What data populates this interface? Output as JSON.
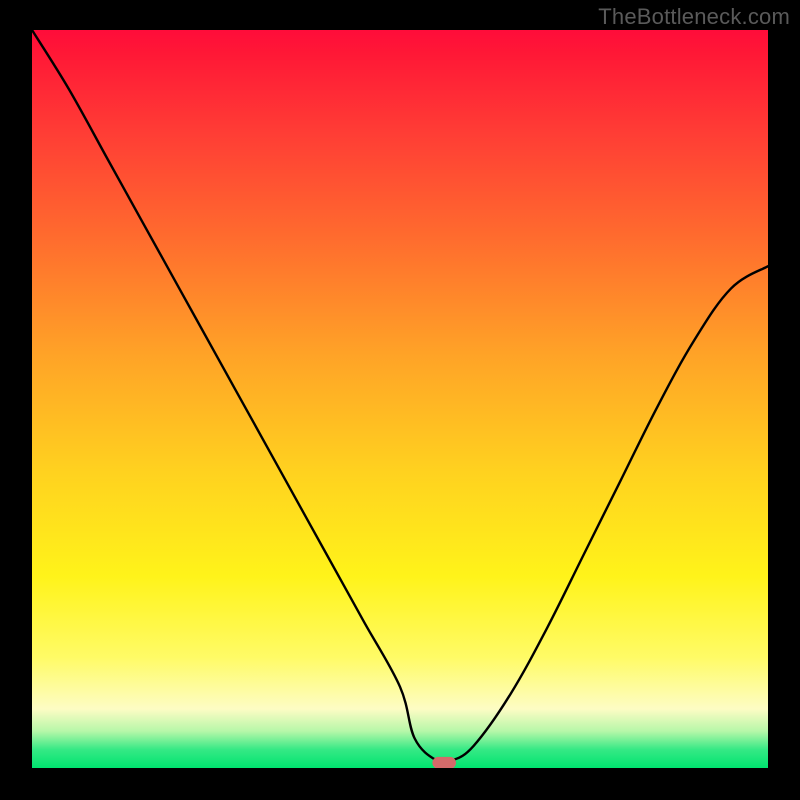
{
  "watermark": "TheBottleneck.com",
  "colors": {
    "frame_bg": "#000000",
    "watermark_text": "#5a5a5a",
    "curve_stroke": "#000000",
    "marker_fill": "#d46a6a",
    "gradient_stops": [
      "#ff0c3a",
      "#ff1736",
      "#ff3d35",
      "#ff6b2e",
      "#ffa327",
      "#ffd21f",
      "#fff31a",
      "#fffb66",
      "#fdfcc4",
      "#b7f7a9",
      "#35e985",
      "#00e46f"
    ]
  },
  "chart_data": {
    "type": "line",
    "title": "",
    "xlabel": "",
    "ylabel": "",
    "xlim": [
      0,
      100
    ],
    "ylim": [
      0,
      100
    ],
    "grid": false,
    "legend": false,
    "background": "vertical red→orange→yellow→green gradient (bottleneck heat map)",
    "series": [
      {
        "name": "bottleneck-curve",
        "x": [
          0,
          5,
          10,
          15,
          20,
          25,
          30,
          35,
          40,
          45,
          50,
          52,
          55,
          57,
          60,
          65,
          70,
          75,
          80,
          85,
          90,
          95,
          100
        ],
        "y": [
          100,
          92,
          83,
          74,
          65,
          56,
          47,
          38,
          29,
          20,
          11,
          4,
          1,
          1,
          3,
          10,
          19,
          29,
          39,
          49,
          58,
          65,
          68
        ]
      }
    ],
    "marker": {
      "name": "optimal-point",
      "shape": "rounded-rect",
      "x": 56,
      "y": 0.7,
      "width_pct": 3.2,
      "height_pct": 1.6
    },
    "notes": "Axes are unlabeled in the image; values are normalized 0–100 by position. The curve depicts a V-shaped bottleneck profile with its minimum near x≈55–57. A small salmon pill marks the minimum on the near-zero baseline."
  }
}
